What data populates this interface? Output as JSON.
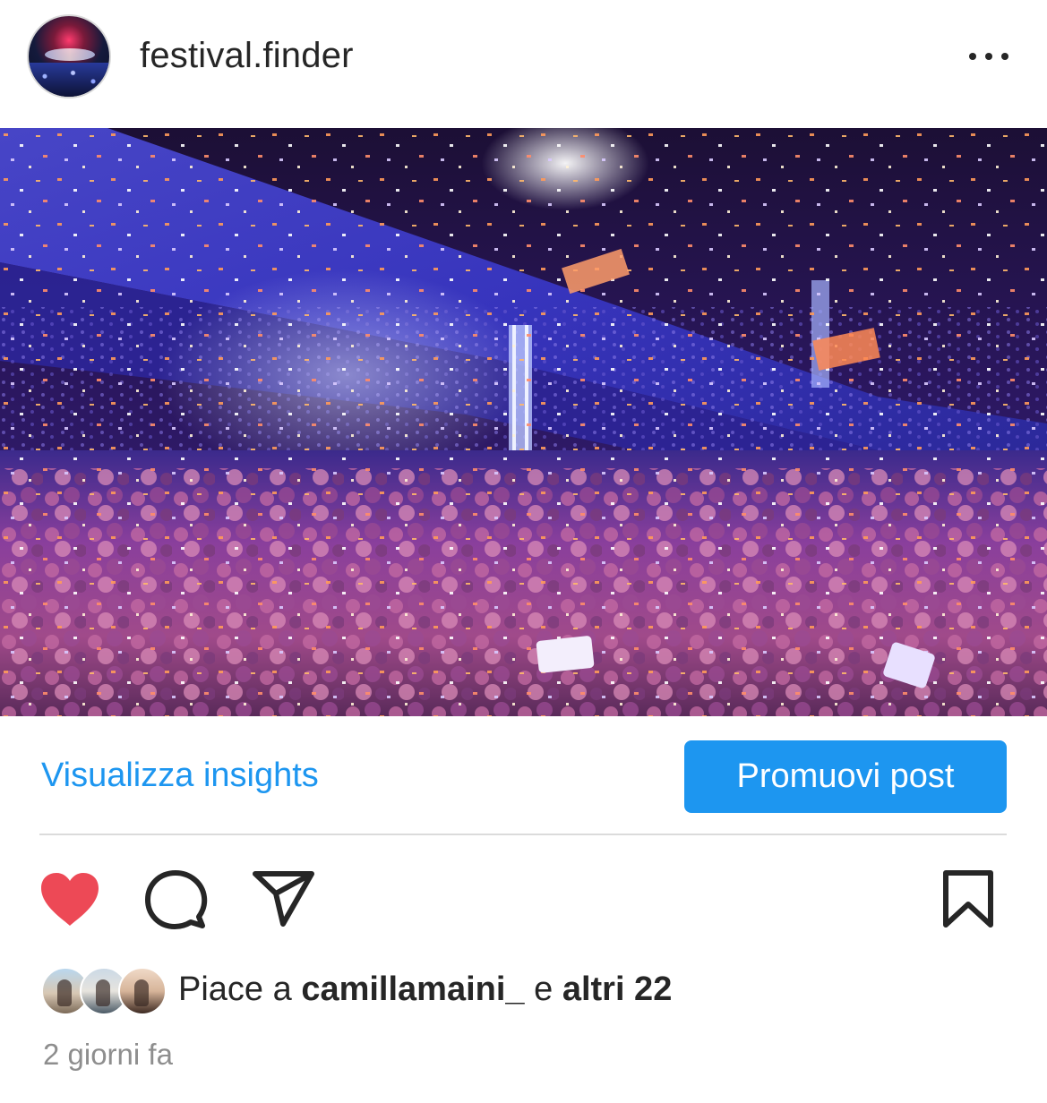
{
  "header": {
    "username": "festival.finder",
    "more_icon": "more-horizontal-icon"
  },
  "photo": {
    "subject": "concert-crowd-confetti"
  },
  "insights": {
    "link_label": "Visualizza insights",
    "promote_label": "Promuovi post",
    "accent_color": "#1d96f0"
  },
  "actions": {
    "like_icon": "heart-filled-icon",
    "like_color": "#ed4956",
    "comment_icon": "comment-icon",
    "share_icon": "paper-plane-icon",
    "save_icon": "bookmark-icon"
  },
  "likes": {
    "prefix": "Piace a ",
    "user": "camillamaini_",
    "connector": " e ",
    "others": "altri 22"
  },
  "timestamp": "2 giorni fa"
}
